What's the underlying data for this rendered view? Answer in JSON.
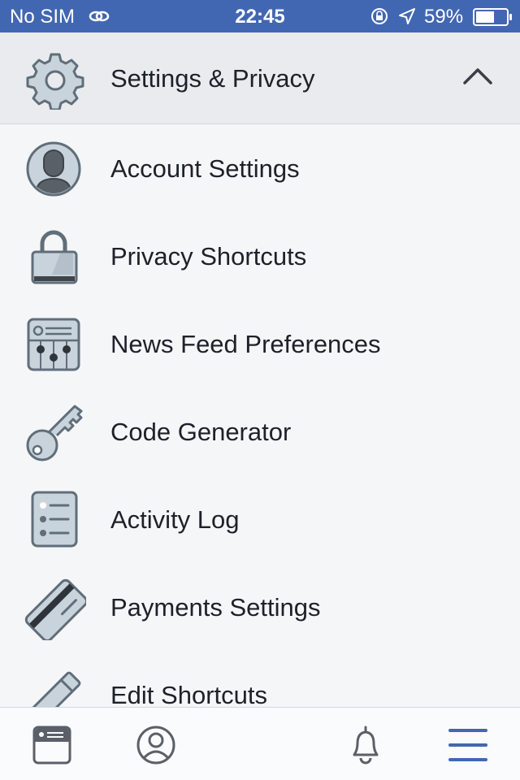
{
  "status_bar": {
    "carrier": "No SIM",
    "time": "22:45",
    "battery": "59%"
  },
  "header": {
    "title": "Settings & Privacy",
    "icon": "gear-icon",
    "expand_icon": "chevron-up-icon"
  },
  "menu": {
    "items": [
      {
        "label": "Account Settings",
        "icon": "account-icon"
      },
      {
        "label": "Privacy Shortcuts",
        "icon": "lock-icon"
      },
      {
        "label": "News Feed Preferences",
        "icon": "news-feed-preferences-icon"
      },
      {
        "label": "Code Generator",
        "icon": "key-icon"
      },
      {
        "label": "Activity Log",
        "icon": "activity-log-icon"
      },
      {
        "label": "Payments Settings",
        "icon": "credit-card-icon"
      },
      {
        "label": "Edit Shortcuts",
        "icon": "pencil-icon"
      }
    ]
  },
  "tab_bar": {
    "tabs": [
      {
        "name": "news-feed",
        "icon": "news-feed-icon",
        "active": false
      },
      {
        "name": "profile",
        "icon": "profile-icon",
        "active": false
      },
      {
        "name": "notifications",
        "icon": "bell-icon",
        "active": false
      },
      {
        "name": "menu",
        "icon": "hamburger-menu-icon",
        "active": true
      }
    ]
  },
  "colors": {
    "status_bar_bg": "#4267b2",
    "header_bg": "#e9ebee",
    "list_bg": "#f5f6f8",
    "icon_fill": "#c9d3dc",
    "icon_stroke": "#606e7a",
    "active_tab": "#4267b2",
    "text": "#1d2129"
  }
}
